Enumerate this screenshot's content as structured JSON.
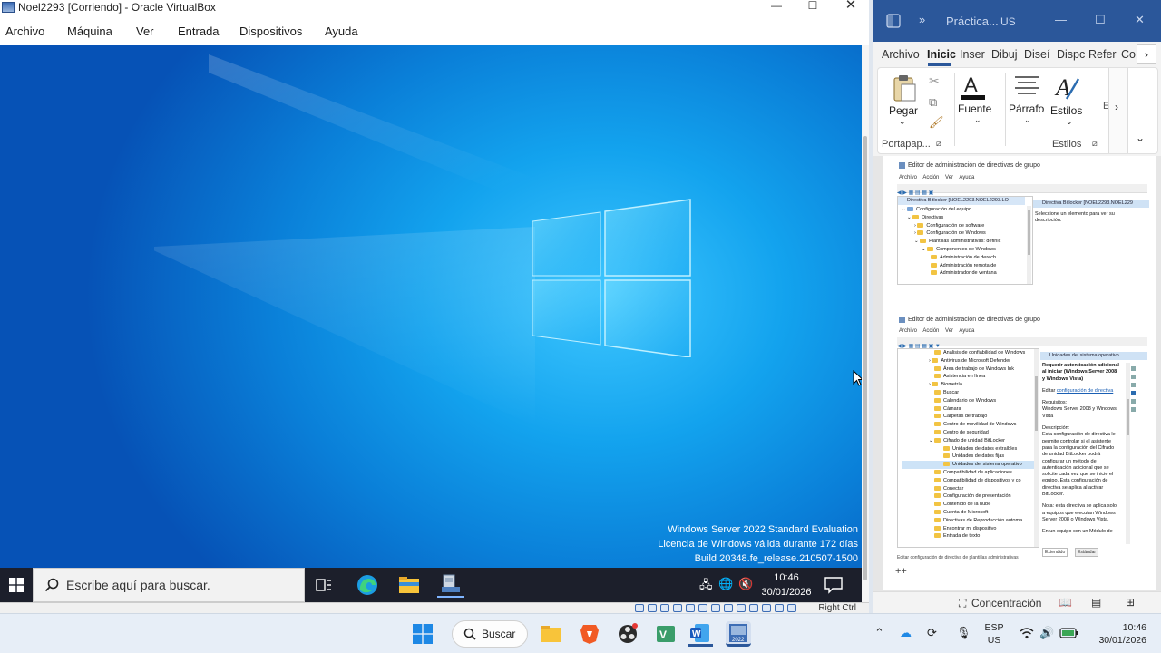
{
  "vbox": {
    "title": "Noel2293 [Corriendo] - Oracle VirtualBox",
    "menu": [
      "Archivo",
      "Máquina",
      "Ver",
      "Entrada",
      "Dispositivos",
      "Ayuda"
    ],
    "status_key": "Right Ctrl"
  },
  "guest": {
    "watermark": {
      "line1": "Windows Server 2022 Standard Evaluation",
      "line2": "Licencia de Windows válida durante 172 días",
      "line3": "Build 20348.fe_release.210507-1500"
    },
    "taskbar": {
      "search_placeholder": "Escribe aquí para buscar.",
      "time": "10:46",
      "date": "30/01/2026"
    }
  },
  "word": {
    "title": "Práctica...",
    "user_initials": "US",
    "tabs": [
      "Archivo",
      "Inicio",
      "Insertar",
      "Dibujar",
      "Diseño",
      "Disposición",
      "Referencias",
      "Co"
    ],
    "tab_labels_visible": [
      "Archivo",
      "Inicic",
      "Inser",
      "Dibuj",
      "Diseí",
      "Dispc",
      "Refer",
      "Co"
    ],
    "active_tab": "Inicio",
    "ribbon": {
      "pegar": "Pegar",
      "fuente": "Fuente",
      "parrafo": "Párrafo",
      "estilos": "Estilos",
      "group_portapapeles": "Portapap...",
      "group_estilos": "Estilos",
      "more": "E"
    },
    "status": {
      "focus_mode": "Concentración"
    },
    "doc_marker": "++",
    "gpe1": {
      "title": "Editor de administración de directivas de grupo",
      "menu": [
        "Archivo",
        "Acción",
        "Ver",
        "Ayuda"
      ],
      "root": "Directiva Bitlocker [NOEL2293.NOEL2293.LO",
      "tree": [
        "Configuración del equipo",
        "Directivas",
        "Configuración de software",
        "Configuración de Windows",
        "Plantillas administrativas: definic",
        "Componentes de Windows",
        "Administración de derech",
        "Administración remota de",
        "Administrador de ventana"
      ],
      "pane_head": "Directiva Bitlocker [NOEL2293.NOEL229",
      "pane_text": "Seleccione un elemento para ver su descripción."
    },
    "gpe2": {
      "title": "Editor de administración de directivas de grupo",
      "menu": [
        "Archivo",
        "Acción",
        "Ver",
        "Ayuda"
      ],
      "tree": [
        "Análisis de confiabilidad de Windows",
        "Antivirus de Microsoft Defender",
        "Área de trabajo de Windows Ink",
        "Asistencia en línea",
        "Biometría",
        "Buscar",
        "Calendario de Windows",
        "Cámara",
        "Carpetas de trabajo",
        "Centro de movilidad de Windows",
        "Centro de seguridad",
        "Cifrado de unidad BitLocker",
        "Unidades de datos extraíbles",
        "Unidades de datos fijas",
        "Unidades del sistema operativo",
        "Compatibilidad de aplicaciones",
        "Compatibilidad de dispositivos y co",
        "Conectar",
        "Configuración de presentación",
        "Contenido de la nube",
        "Cuenta de Microsoft",
        "Directivas de Reproducción automa",
        "Encontrar mi dispositivo",
        "Entrada de texto"
      ],
      "pane_head": "Unidades del sistema operativo",
      "setting_title": "Requerir autenticación adicional al iniciar (Windows Server 2008 y Windows Vista)",
      "edit_label": "Editar",
      "edit_link": "configuración de directiva",
      "req_label": "Requisitos:",
      "req_text": "Windows Server 2008 y Windows Vista",
      "desc_label": "Descripción:",
      "desc_text": "Esta configuración de directiva le permite controlar si el asistente para la configuración del Cifrado de unidad BitLocker podrá configurar un método de autenticación adicional que se solicite cada vez que se inicie el equipo. Esta configuración de directiva se aplica al activar BitLocker.",
      "note_text": "Nota: esta directiva se aplica solo a equipos que ejecutan Windows Server 2008 o Windows Vista.",
      "more_text": "En un equipo con un Módulo de",
      "tab_ext": "Extendido",
      "tab_std": "Estándar",
      "status_line": "Editar configuración de directiva de plantillas administrativas"
    }
  },
  "host": {
    "search_label": "Buscar",
    "lang_line1": "ESP",
    "lang_line2": "US",
    "time": "10:46",
    "date": "30/01/2026"
  },
  "colors": {
    "word_blue": "#2b579a",
    "guest_taskbar": "#1c1f2b",
    "host_taskbar": "#e7eef7"
  },
  "icons": [
    "windows-logo-icon",
    "search-icon",
    "task-view-icon",
    "edge-icon",
    "file-explorer-icon",
    "server-manager-icon",
    "wifi-icon",
    "volume-icon",
    "battery-icon",
    "notification-icon",
    "clipboard-icon",
    "scissors-icon",
    "copy-icon",
    "format-painter-icon",
    "font-icon",
    "paragraph-icon",
    "styles-icon"
  ]
}
